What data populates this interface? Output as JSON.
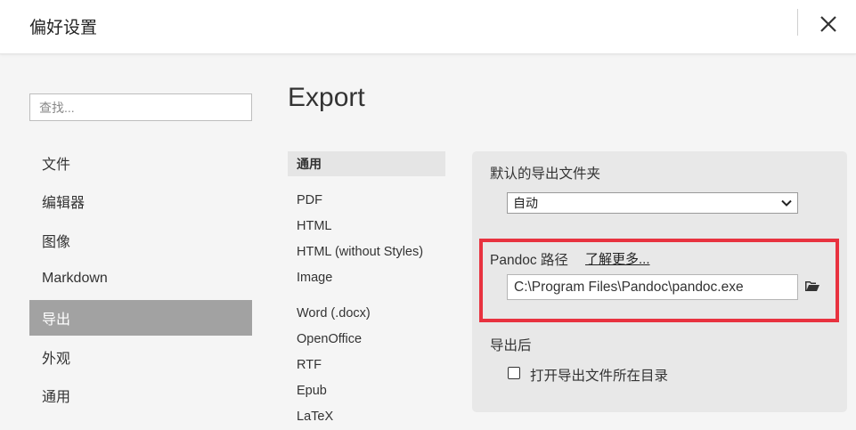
{
  "window": {
    "title": "偏好设置",
    "close_icon": "close-icon"
  },
  "search": {
    "placeholder": "查找..."
  },
  "nav": {
    "items": [
      {
        "label": "文件"
      },
      {
        "label": "编辑器"
      },
      {
        "label": "图像"
      },
      {
        "label": "Markdown"
      },
      {
        "label": "导出",
        "active": true
      },
      {
        "label": "外观"
      },
      {
        "label": "通用"
      }
    ]
  },
  "main": {
    "title": "Export"
  },
  "export_list": {
    "items": [
      {
        "label": "通用",
        "active": true
      },
      {
        "label": "PDF"
      },
      {
        "label": "HTML"
      },
      {
        "label": "HTML (without Styles)"
      },
      {
        "label": "Image"
      },
      {
        "label": "Word (.docx)"
      },
      {
        "label": "OpenOffice"
      },
      {
        "label": "RTF"
      },
      {
        "label": "Epub"
      },
      {
        "label": "LaTeX"
      }
    ]
  },
  "settings": {
    "default_folder_label": "默认的导出文件夹",
    "default_folder_value": "自动",
    "pandoc_label": "Pandoc 路径",
    "learn_more": "了解更多...",
    "pandoc_path": "C:\\Program Files\\Pandoc\\pandoc.exe",
    "after_export_label": "导出后",
    "open_folder_label": "打开导出文件所在目录",
    "open_folder_checked": false
  },
  "colors": {
    "highlight": "#e8323f",
    "nav_active_bg": "#a2a2a2",
    "panel_bg": "#e8e8e8"
  }
}
